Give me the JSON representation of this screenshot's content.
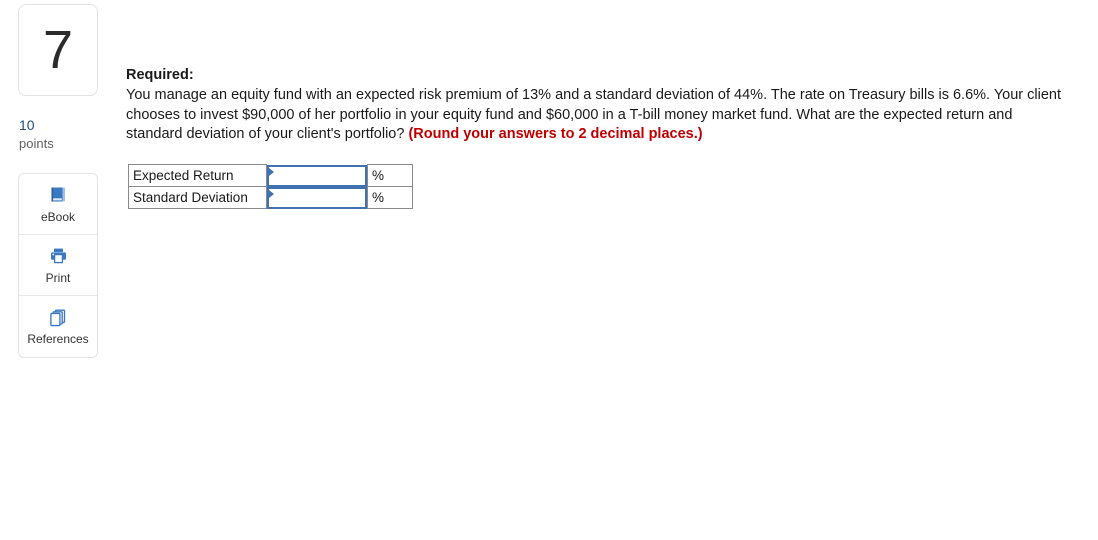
{
  "sidebar": {
    "question_number": "7",
    "points_value": "10",
    "points_label": "points",
    "tools": [
      {
        "label": "eBook",
        "icon": "book-icon"
      },
      {
        "label": "Print",
        "icon": "printer-icon"
      },
      {
        "label": "References",
        "icon": "copy-pages-icon"
      }
    ]
  },
  "question": {
    "required_heading": "Required:",
    "body_text": "You manage an equity fund with an expected risk premium of 13% and a standard deviation of 44%. The rate on Treasury bills is 6.6%. Your client chooses to invest $90,000 of her portfolio in your equity fund and $60,000 in a T-bill money market fund. What are the expected return and standard deviation of your client's portfolio? ",
    "round_note": "(Round your answers to 2 decimal places.)",
    "round_note_color": "#c00000"
  },
  "answer_table": {
    "rows": [
      {
        "label": "Expected Return",
        "value": "",
        "placeholder": "",
        "unit": "%"
      },
      {
        "label": "Standard Deviation",
        "value": "",
        "placeholder": "",
        "unit": "%"
      }
    ]
  },
  "colors": {
    "accent_blue": "#3f72b0",
    "icon_blue": "#3b78c2",
    "points_blue": "#1f4e79",
    "border_gray": "#8a8a8a",
    "panel_border": "#e3e3e3"
  }
}
